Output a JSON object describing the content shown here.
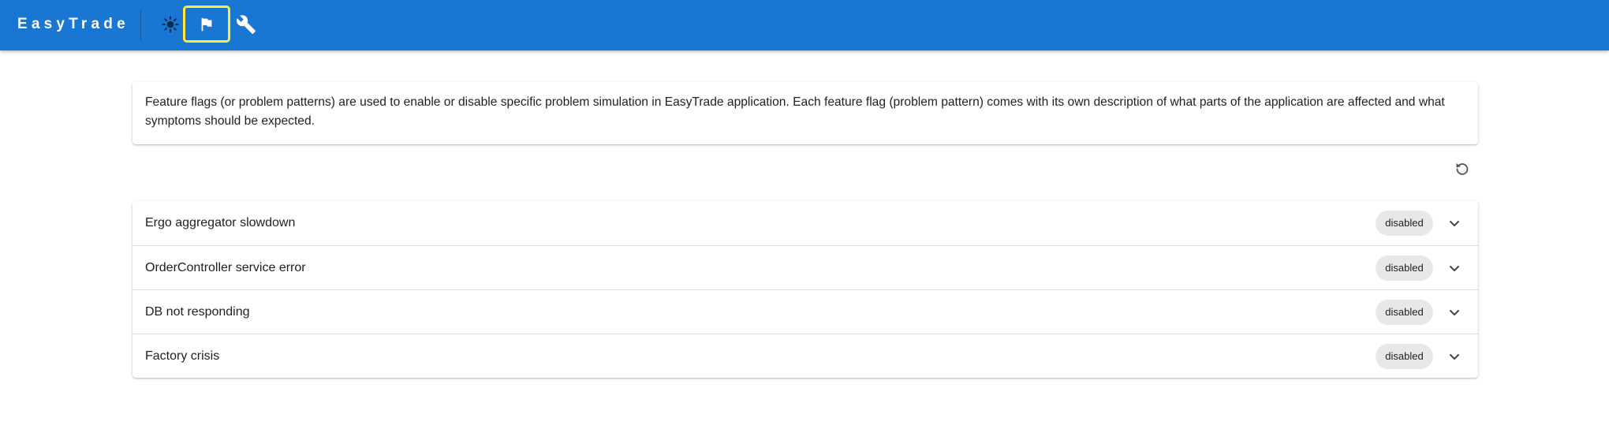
{
  "appbar": {
    "brand": "EasyTrade",
    "nav": [
      {
        "icon": "sun-icon",
        "label": "theme toggle"
      },
      {
        "icon": "flag-icon",
        "label": "feature flags",
        "active": true
      },
      {
        "icon": "wrench-icon",
        "label": "settings"
      }
    ],
    "colors": {
      "bar": "#1976d2",
      "active_outline": "#ffeb3b"
    }
  },
  "description": "Feature flags (or problem patterns) are used to enable or disable specific problem simulation in EasyTrade application. Each feature flag (problem pattern) comes with its own description of what parts of the application are affected and what symptoms should be expected.",
  "toolbar": {
    "refresh_icon": "refresh-icon"
  },
  "flags": [
    {
      "name": "Ergo aggregator slowdown",
      "status": "disabled"
    },
    {
      "name": "OrderController service error",
      "status": "disabled"
    },
    {
      "name": "DB not responding",
      "status": "disabled"
    },
    {
      "name": "Factory crisis",
      "status": "disabled"
    }
  ]
}
